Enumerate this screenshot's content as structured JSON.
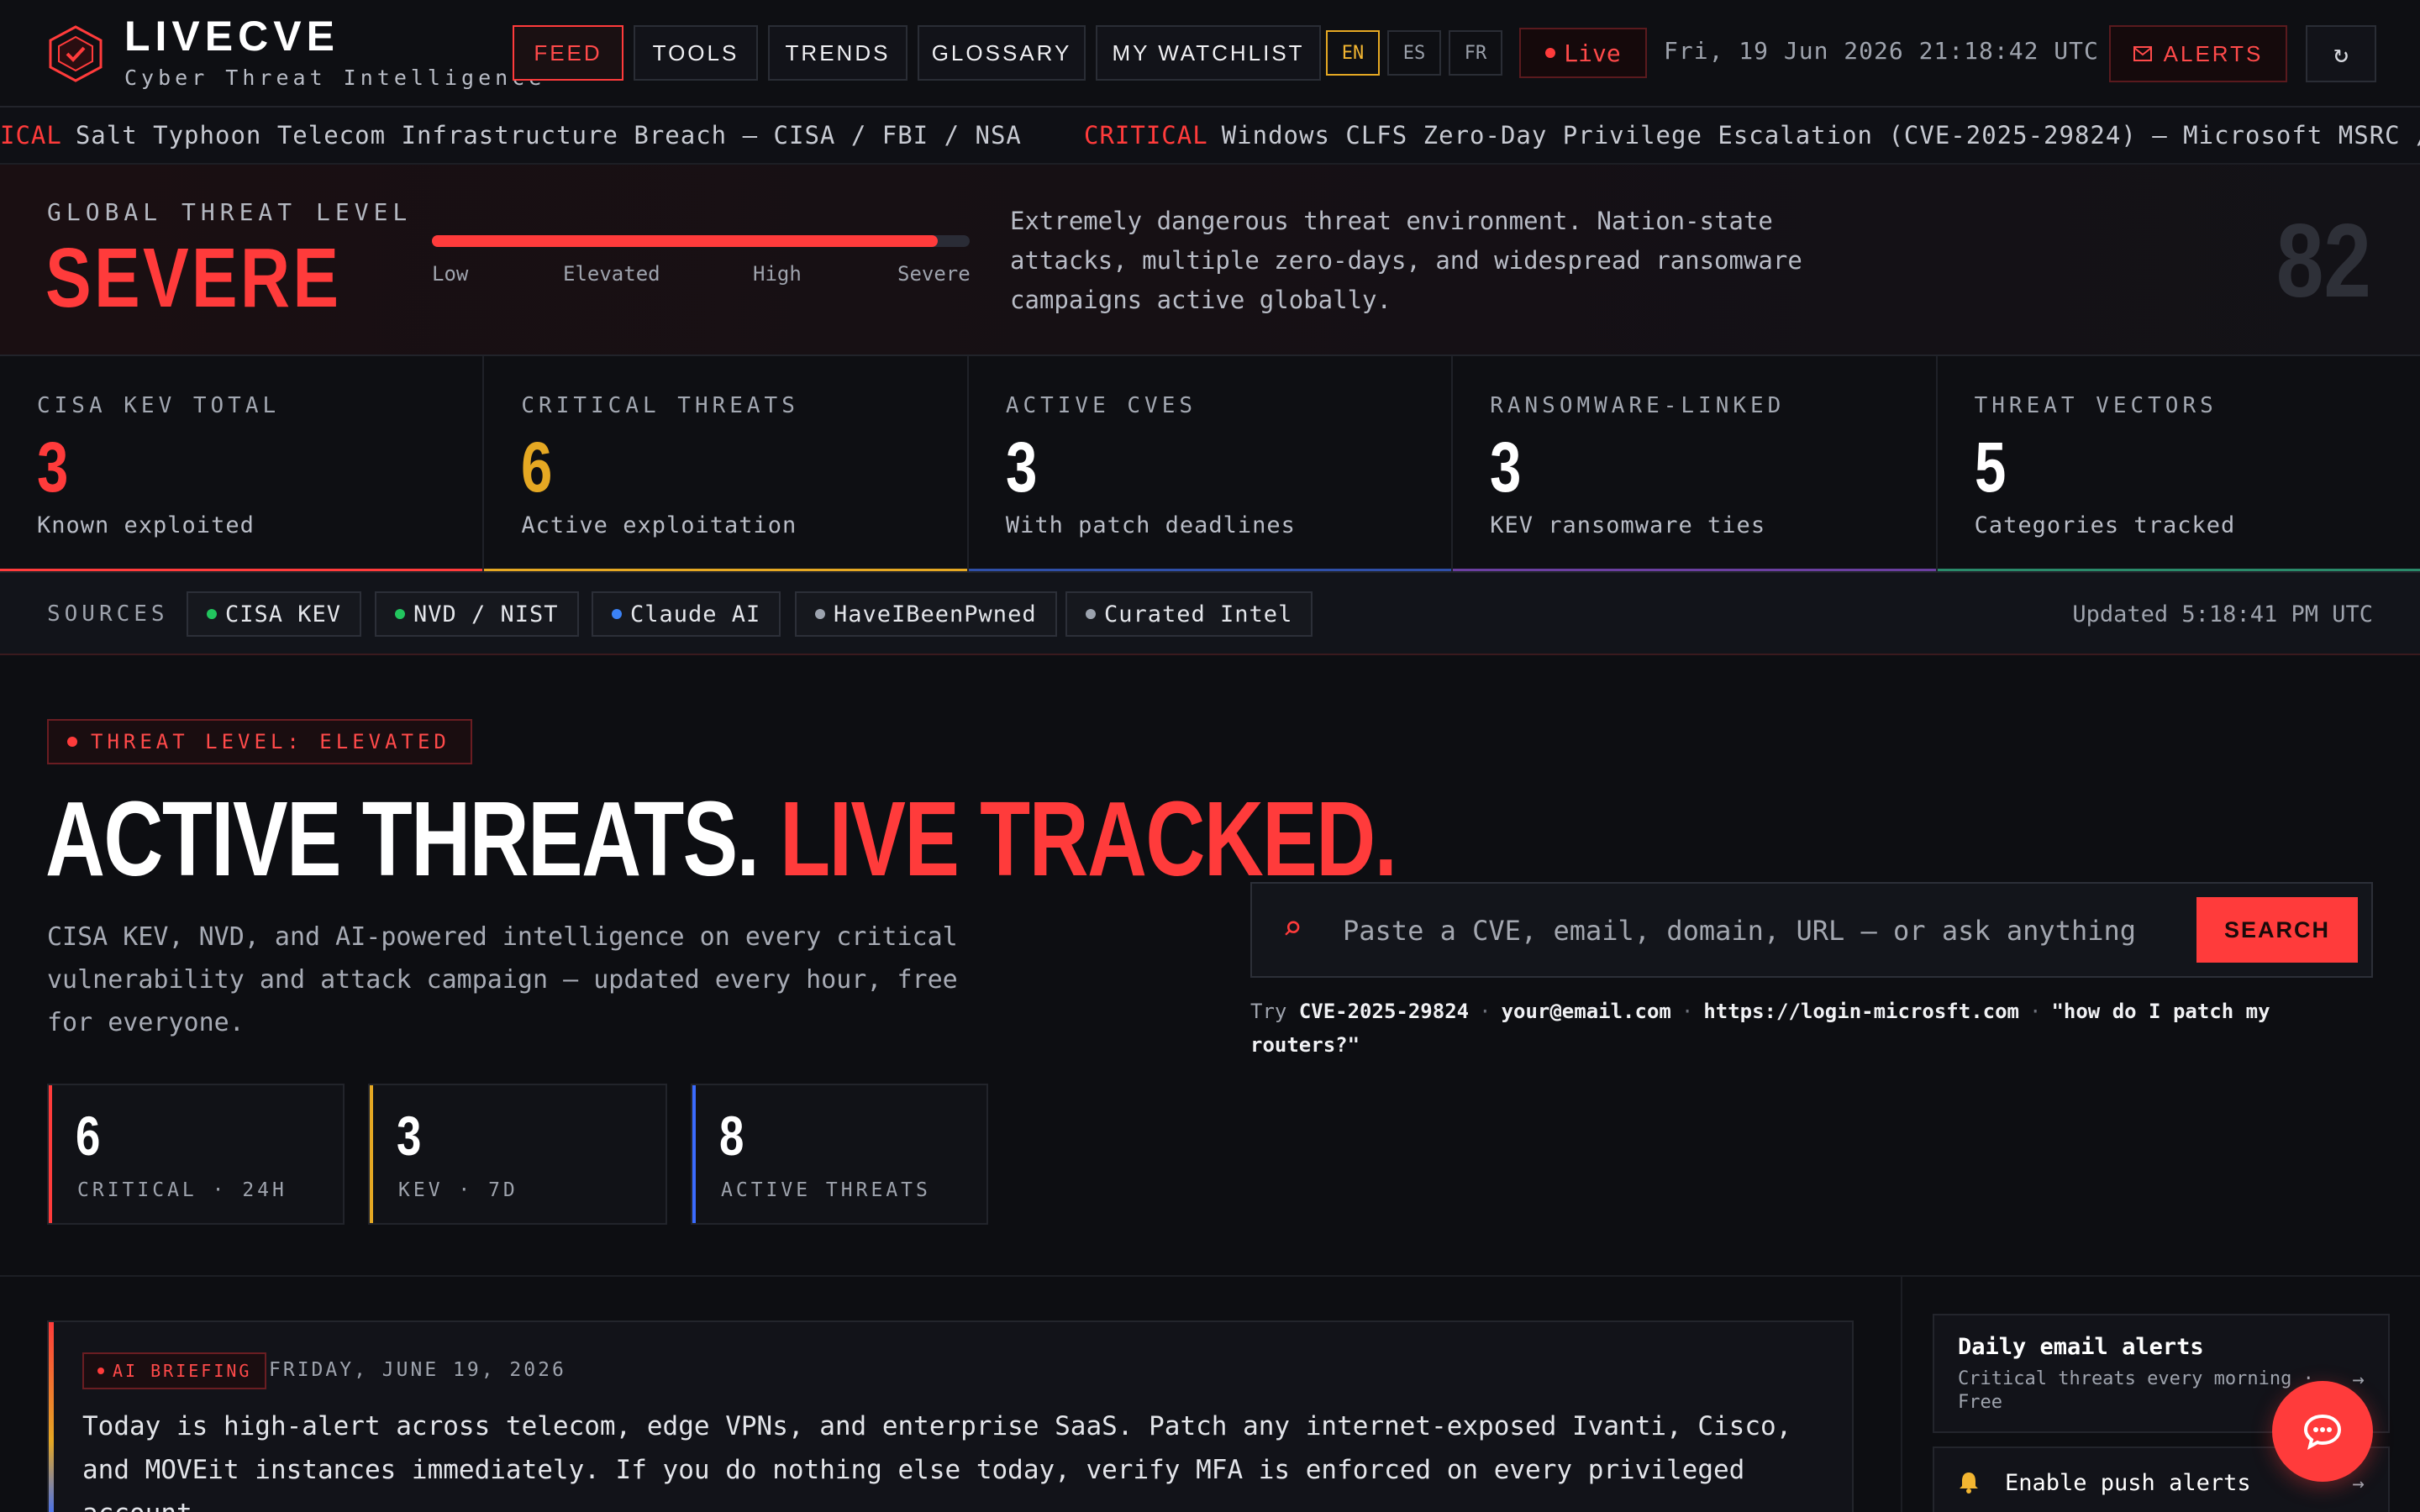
{
  "brand": {
    "name": "LIVECVE",
    "tagline": "Cyber Threat Intelligence"
  },
  "nav": {
    "items": [
      "FEED",
      "TOOLS",
      "TRENDS",
      "GLOSSARY",
      "MY WATCHLIST"
    ],
    "active": "FEED",
    "languages": [
      "EN",
      "ES",
      "FR"
    ],
    "active_language": "EN",
    "live_label": "Live",
    "clock": "Fri, 19 Jun 2026 21:18:42 UTC",
    "alerts_label": "ALERTS",
    "refresh_icon": "↻"
  },
  "ticker": [
    {
      "severity": "ICAL",
      "text": "Salt Typhoon Telecom Infrastructure Breach — CISA / FBI / NSA"
    },
    {
      "severity": "CRITICAL",
      "text": "Windows CLFS Zero-Day Privilege Escalation (CVE-2025-29824) — Microsoft MSRC / CI"
    }
  ],
  "threat_level": {
    "label": "GLOBAL THREAT LEVEL",
    "value": "SEVERE",
    "meter_fraction": 0.94,
    "scale": [
      "Low",
      "Elevated",
      "High",
      "Severe"
    ],
    "description": "Extremely dangerous threat environment. Nation-state attacks, multiple zero-days, and widespread ransomware campaigns active globally.",
    "score": "82"
  },
  "stats": [
    {
      "label": "CISA KEV TOTAL",
      "value": "3",
      "sub": "Known exploited",
      "color": "#ff3b3b"
    },
    {
      "label": "CRITICAL THREATS",
      "value": "6",
      "sub": "Active exploitation",
      "color": "#e5a823"
    },
    {
      "label": "ACTIVE CVES",
      "value": "3",
      "sub": "With patch deadlines",
      "color": "#ffffff"
    },
    {
      "label": "RANSOMWARE-LINKED",
      "value": "3",
      "sub": "KEV ransomware ties",
      "color": "#ffffff"
    },
    {
      "label": "THREAT VECTORS",
      "value": "5",
      "sub": "Categories tracked",
      "color": "#ffffff"
    }
  ],
  "sources": {
    "label": "SOURCES",
    "items": [
      {
        "name": "CISA KEV",
        "dot": "#22c55e"
      },
      {
        "name": "NVD / NIST",
        "dot": "#22c55e"
      },
      {
        "name": "Claude AI",
        "dot": "#3b82f6"
      },
      {
        "name": "HaveIBeenPwned",
        "dot": "#9ca3af"
      },
      {
        "name": "Curated Intel",
        "dot": "#9ca3af"
      }
    ],
    "updated": "Updated 5:18:41 PM UTC"
  },
  "hero": {
    "badge": "THREAT LEVEL: ELEVATED",
    "title_white": "ACTIVE THREATS.",
    "title_red": "LIVE TRACKED.",
    "subtitle": "CISA KEV, NVD, and AI-powered intelligence on every critical vulnerability and attack campaign — updated every hour, free for everyone.",
    "mini_stats": [
      {
        "value": "6",
        "label": "CRITICAL · 24H",
        "color": "#ff3b3b"
      },
      {
        "value": "3",
        "label": "KEV · 7D",
        "color": "#e5a823"
      },
      {
        "value": "8",
        "label": "ACTIVE THREATS",
        "color": "#3b6cff"
      }
    ]
  },
  "search": {
    "placeholder": "Paste a CVE, email, domain, URL — or ask anything",
    "button": "SEARCH",
    "try_label": "Try",
    "examples": [
      "CVE-2025-29824",
      "your@email.com",
      "https://login-microsft.com",
      "\"how do I patch my routers?\""
    ]
  },
  "briefing": {
    "badge": "AI BRIEFING",
    "date": "FRIDAY, JUNE 19, 2026",
    "text": "Today is high-alert across telecom, edge VPNs, and enterprise SaaS. Patch any internet-exposed Ivanti, Cisco, and MOVEit instances immediately. If you do nothing else today, verify MFA is enforced on every privileged account."
  },
  "sidebar": {
    "email_title": "Daily email alerts",
    "email_sub": "Critical threats every morning · Free",
    "push_label": "Enable push alerts",
    "arrow": "→"
  }
}
